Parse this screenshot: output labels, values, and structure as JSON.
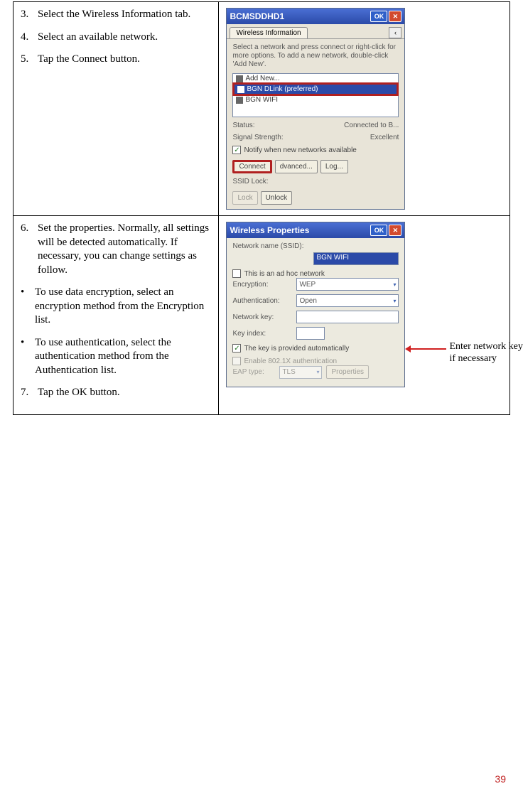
{
  "row1": {
    "step3_num": "3.",
    "step3_text": "Select the Wireless Information tab.",
    "step4_num": "4.",
    "step4_text": "Select an available network.",
    "step5_num": "5.",
    "step5_text": "Tap the Connect button."
  },
  "row2": {
    "step6_num": "6.",
    "step6_text": "Set the properties. Normally, all settings will be detected automatically. If necessary, you can change settings as follow.",
    "bullet1": "To use data encryption, select an encryption method from the Encryption list.",
    "bullet2": "To use authentication, select the authentication method from the Authentication list.",
    "step7_num": "7.",
    "step7_text": " Tap the OK button."
  },
  "scr1": {
    "title": "BCMSDDHD1",
    "ok": "OK",
    "close": "✕",
    "tab": "Wireless Information",
    "tabscroll": "‹",
    "help": "Select a network and press connect or right-click for more options.  To add a new network, double-click 'Add New'.",
    "net_addnew": "Add New...",
    "net_sel": "BGN DLink (preferred)",
    "net3": "BGN WIFI",
    "status_label": "Status:",
    "status_val": "Connected to B...",
    "signal_label": "Signal Strength:",
    "signal_val": "Excellent",
    "notify": "Notify when new networks available",
    "btn_connect": "Connect",
    "btn_adv": "dvanced...",
    "btn_log": "Log...",
    "ssid_lock": "SSID Lock:",
    "btn_lock": "Lock",
    "btn_unlock": "Unlock"
  },
  "scr2": {
    "title": "Wireless Properties",
    "ok": "OK",
    "close": "✕",
    "ssid_label": "Network name (SSID):",
    "ssid_val": "BGN WIFI",
    "adhoc": "This is an ad hoc network",
    "enc_label": "Encryption:",
    "enc_val": "WEP",
    "auth_label": "Authentication:",
    "auth_val": "Open",
    "key_label": "Network key:",
    "keyidx_label": "Key index:",
    "auto": "The key is provided automatically",
    "enable8021x": "Enable 802.1X authentication",
    "eap_label": "EAP type:",
    "eap_val": "TLS",
    "prop_btn": "Properties"
  },
  "annotation": "Enter network key if necessary",
  "page_number": "39"
}
